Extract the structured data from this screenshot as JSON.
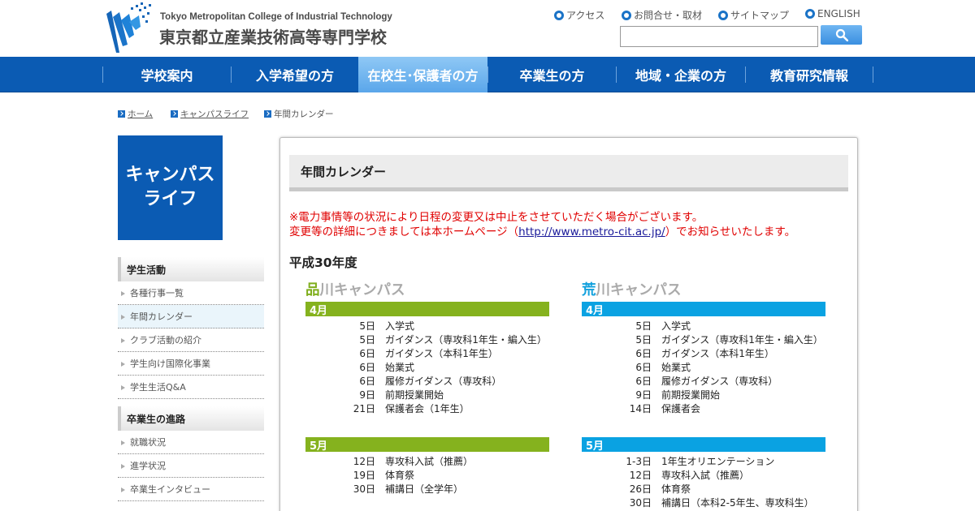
{
  "header": {
    "logo_en": "Tokyo Metropolitan College of Industrial Technology",
    "logo_jp": "東京都立産業技術高等専門学校",
    "utility_links": [
      "アクセス",
      "お問合せ・取材",
      "サイトマップ",
      "ENGLISH"
    ],
    "search": {
      "value": "",
      "placeholder": ""
    }
  },
  "gnav": {
    "items": [
      {
        "label": "学校案内"
      },
      {
        "label": "入学希望の方"
      },
      {
        "label": "在校生･保護者の方"
      },
      {
        "label": "卒業生の方"
      },
      {
        "label": "地域・企業の方"
      },
      {
        "label": "教育研究情報"
      }
    ]
  },
  "breadcrumb": [
    "ホーム",
    "キャンパスライフ",
    "年間カレンダー"
  ],
  "sidebar": {
    "hero_line1": "キャンパス",
    "hero_line2": "ライフ",
    "group1_title": "学生活動",
    "group1_items": [
      "各種行事一覧",
      "年間カレンダー",
      "クラブ活動の紹介",
      "学生向け国際化事業",
      "学生生活Q&A"
    ],
    "group2_title": "卒業生の進路",
    "group2_items": [
      "就職状況",
      "進学状況",
      "卒業生インタビュー"
    ]
  },
  "main": {
    "title": "年間カレンダー",
    "notice_line1": "※電力事情等の状況により日程の変更又は中止をさせていただく場合がございます。",
    "notice_line2_pre": "変更等の詳細につきましては本ホームページ（",
    "notice_link": "http://www.metro-cit.ac.jp/",
    "notice_line2_post": "）でお知らせいたします。",
    "year": "平成30年度",
    "campuses": [
      {
        "first": "品",
        "rest": "川キャンパス",
        "color": "#85b21e",
        "months": [
          {
            "label": "4月",
            "events": [
              {
                "day": "5日",
                "text": "入学式"
              },
              {
                "day": "5日",
                "text": "ガイダンス（専攻科1年生・編入生）"
              },
              {
                "day": "6日",
                "text": "ガイダンス（本科1年生）"
              },
              {
                "day": "6日",
                "text": "始業式"
              },
              {
                "day": "6日",
                "text": "履修ガイダンス（専攻科）"
              },
              {
                "day": "9日",
                "text": "前期授業開始"
              },
              {
                "day": "21日",
                "text": "保護者会（1年生）"
              }
            ]
          },
          {
            "label": "5月",
            "events": [
              {
                "day": "12日",
                "text": "専攻科入試（推薦）"
              },
              {
                "day": "19日",
                "text": "体育祭"
              },
              {
                "day": "30日",
                "text": "補講日（全学年）"
              }
            ]
          }
        ]
      },
      {
        "first": "荒",
        "rest": "川キャンパス",
        "color": "#0aa2e2",
        "months": [
          {
            "label": "4月",
            "events": [
              {
                "day": "5日",
                "text": "入学式"
              },
              {
                "day": "5日",
                "text": "ガイダンス（専攻科1年生・編入生）"
              },
              {
                "day": "6日",
                "text": "ガイダンス（本科1年生）"
              },
              {
                "day": "6日",
                "text": "始業式"
              },
              {
                "day": "6日",
                "text": "履修ガイダンス（専攻科）"
              },
              {
                "day": "9日",
                "text": "前期授業開始"
              },
              {
                "day": "14日",
                "text": "保護者会"
              }
            ]
          },
          {
            "label": "5月",
            "events": [
              {
                "day": "1-3日",
                "text": "1年生オリエンテーション"
              },
              {
                "day": "12日",
                "text": "専攻科入試（推薦）"
              },
              {
                "day": "26日",
                "text": "体育祭"
              },
              {
                "day": "30日",
                "text": "補講日（本科2-5年生、専攻科生）"
              }
            ]
          }
        ]
      }
    ]
  }
}
